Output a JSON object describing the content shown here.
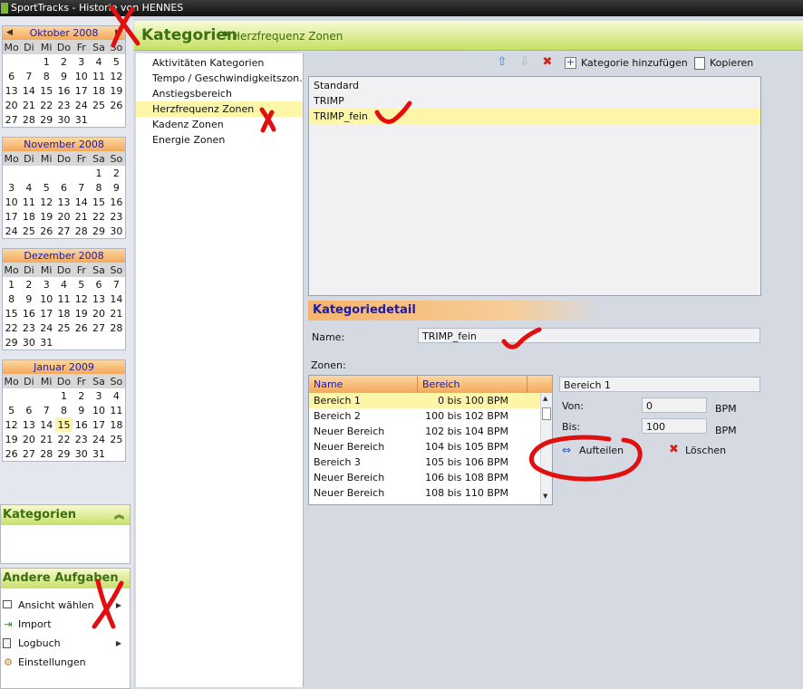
{
  "window": {
    "title": "SportTracks - Historie von HENNES"
  },
  "calendars": [
    {
      "month": "Oktober 2008",
      "weeks": [
        [
          "",
          "",
          "1",
          "2",
          "3",
          "4",
          "5"
        ],
        [
          "6",
          "7",
          "8",
          "9",
          "10",
          "11",
          "12"
        ],
        [
          "13",
          "14",
          "15",
          "16",
          "17",
          "18",
          "19"
        ],
        [
          "20",
          "21",
          "22",
          "23",
          "24",
          "25",
          "26"
        ],
        [
          "27",
          "28",
          "29",
          "30",
          "31",
          "",
          ""
        ]
      ]
    },
    {
      "month": "November 2008",
      "weeks": [
        [
          "",
          "",
          "",
          "",
          "",
          "1",
          "2"
        ],
        [
          "3",
          "4",
          "5",
          "6",
          "7",
          "8",
          "9"
        ],
        [
          "10",
          "11",
          "12",
          "13",
          "14",
          "15",
          "16"
        ],
        [
          "17",
          "18",
          "19",
          "20",
          "21",
          "22",
          "23"
        ],
        [
          "24",
          "25",
          "26",
          "27",
          "28",
          "29",
          "30"
        ]
      ]
    },
    {
      "month": "Dezember 2008",
      "weeks": [
        [
          "1",
          "2",
          "3",
          "4",
          "5",
          "6",
          "7"
        ],
        [
          "8",
          "9",
          "10",
          "11",
          "12",
          "13",
          "14"
        ],
        [
          "15",
          "16",
          "17",
          "18",
          "19",
          "20",
          "21"
        ],
        [
          "22",
          "23",
          "24",
          "25",
          "26",
          "27",
          "28"
        ],
        [
          "29",
          "30",
          "31",
          "",
          "",
          "",
          ""
        ]
      ]
    },
    {
      "month": "Januar 2009",
      "weeks": [
        [
          "",
          "",
          "",
          "1",
          "2",
          "3",
          "4"
        ],
        [
          "5",
          "6",
          "7",
          "8",
          "9",
          "10",
          "11"
        ],
        [
          "12",
          "13",
          "14",
          "15",
          "16",
          "17",
          "18"
        ],
        [
          "19",
          "20",
          "21",
          "22",
          "23",
          "24",
          "25"
        ],
        [
          "26",
          "27",
          "28",
          "29",
          "30",
          "31",
          ""
        ]
      ],
      "today": "15"
    }
  ],
  "weekdays": [
    "Mo",
    "Di",
    "Mi",
    "Do",
    "Fr",
    "Sa",
    "So"
  ],
  "panels": {
    "kategorien": {
      "title": "Kategorien"
    },
    "andere": {
      "title": "Andere Aufgaben",
      "items": [
        {
          "label": "Ansicht wählen",
          "icon": "view-icon"
        },
        {
          "label": "Import",
          "icon": "import-icon"
        },
        {
          "label": "Logbuch",
          "icon": "logbook-icon"
        },
        {
          "label": "Einstellungen",
          "icon": "gear-icon"
        }
      ]
    }
  },
  "header": {
    "title": "Kategorien",
    "separator": "•",
    "subtitle": "Herzfrequenz Zonen"
  },
  "categories": [
    "Aktivitäten Kategorien",
    "Tempo / Geschwindigkeitszon...",
    "Anstiegsbereich",
    "Herzfrequenz Zonen",
    "Kadenz Zonen",
    "Energie Zonen"
  ],
  "selected_category": "Herzfrequenz Zonen",
  "toolbar": {
    "add_label": "Kategorie hinzufügen",
    "copy_label": "Kopieren"
  },
  "zone_sets": [
    "Standard",
    "TRIMP",
    "TRIMP_fein"
  ],
  "selected_zone_set": "TRIMP_fein",
  "detail": {
    "title": "Kategoriedetail",
    "name_label": "Name:",
    "name_value": "TRIMP_fein",
    "zones_label": "Zonen:",
    "col_name": "Name",
    "col_range": "Bereich",
    "zones": [
      {
        "name": "Bereich 1",
        "range": "0 bis 100 BPM"
      },
      {
        "name": "Bereich 2",
        "range": "100 bis 102 BPM"
      },
      {
        "name": "Neuer Bereich",
        "range": "102 bis 104 BPM"
      },
      {
        "name": "Neuer Bereich",
        "range": "104 bis 105 BPM"
      },
      {
        "name": "Bereich 3",
        "range": "105 bis 106 BPM"
      },
      {
        "name": "Neuer Bereich",
        "range": "106 bis 108 BPM"
      },
      {
        "name": "Neuer Bereich",
        "range": "108 bis 110 BPM"
      }
    ],
    "zone_name_value": "Bereich 1",
    "from_label": "Von:",
    "from_value": "0",
    "to_label": "Bis:",
    "to_value": "100",
    "unit": "BPM",
    "split_label": "Aufteilen",
    "delete_label": "Löschen"
  },
  "colors": {
    "accent_green": "#3e6e12",
    "header_orange": "#f4a85a",
    "selection": "#fdf6a8",
    "annotation_red": "#e01010"
  }
}
